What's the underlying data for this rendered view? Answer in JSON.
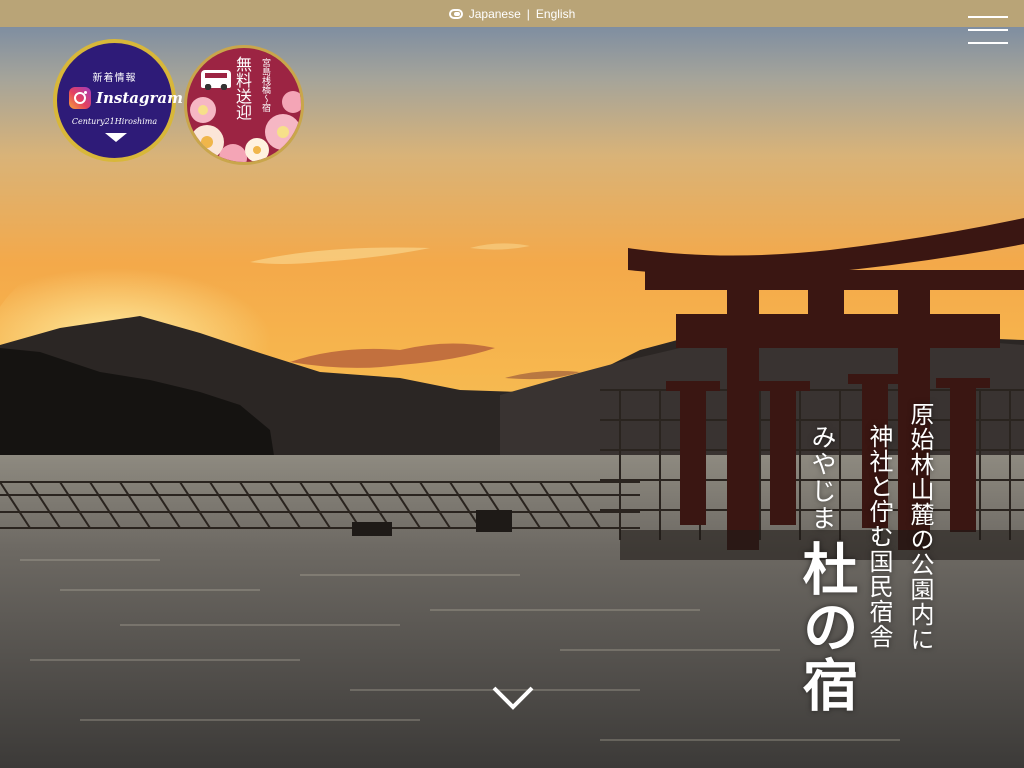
{
  "header": {
    "lang_japanese": "Japanese",
    "lang_separator": "|",
    "lang_english": "English"
  },
  "badges": {
    "instagram": {
      "news_label": "新着情報",
      "brand": "Instagram",
      "handle": "Century21Hiroshima"
    },
    "shuttle": {
      "main_label": "無料送迎",
      "sub_label": "宮島桟橋〜宿"
    }
  },
  "hero": {
    "tagline_line1": "原始林山麓の公園内に",
    "tagline_line2": "神社と佇む国民宿舎",
    "name_kana": "みやじま",
    "name": "杜の宿"
  },
  "colors": {
    "topbar": "#b9a477",
    "instagram_badge": "#2e1b78",
    "shuttle_badge": "#9c2443",
    "badge_border": "#d8b73a",
    "torii": "#3a1612"
  },
  "icons": {
    "language": "language-toggle-icon",
    "menu": "hamburger-menu-icon",
    "scroll": "chevron-down-icon"
  }
}
